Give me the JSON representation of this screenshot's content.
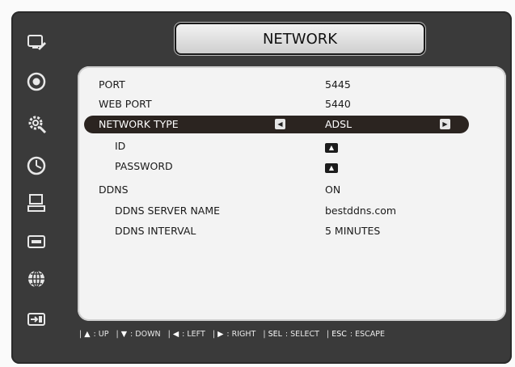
{
  "title": "NETWORK",
  "sidebar": {
    "items": [
      {
        "icon": "monitor-edit-icon"
      },
      {
        "icon": "record-disc-icon"
      },
      {
        "icon": "gear-icon"
      },
      {
        "icon": "clock-icon"
      },
      {
        "icon": "computer-icon"
      },
      {
        "icon": "hdd-icon"
      },
      {
        "icon": "globe-icon"
      },
      {
        "icon": "exit-icon"
      }
    ]
  },
  "settings": {
    "port": {
      "label": "PORT",
      "value": "5445"
    },
    "web_port": {
      "label": "WEB PORT",
      "value": "5440"
    },
    "network_type": {
      "label": "NETWORK TYPE",
      "value": "ADSL",
      "left_arrow": "◀",
      "right_arrow": "▶"
    },
    "id": {
      "label": "ID",
      "value_icon": "keypad-icon",
      "glyph": "▲"
    },
    "password": {
      "label": "PASSWORD",
      "value_icon": "keypad-icon",
      "glyph": "▲"
    },
    "ddns": {
      "label": "DDNS",
      "value": "ON"
    },
    "ddns_server_name": {
      "label": "DDNS SERVER NAME",
      "value": "bestddns.com"
    },
    "ddns_interval": {
      "label": "DDNS INTERVAL",
      "value": "5 MINUTES"
    }
  },
  "help": [
    {
      "key": "▲",
      "action": "UP"
    },
    {
      "key": "▼",
      "action": "DOWN"
    },
    {
      "key": "◀",
      "action": "LEFT"
    },
    {
      "key": "▶",
      "action": "RIGHT"
    },
    {
      "key": "SEL",
      "action": "SELECT"
    },
    {
      "key": "ESC",
      "action": "ESCAPE"
    }
  ],
  "colors": {
    "frame": "#3a3a3a",
    "panel": "#f3f3f3",
    "selected_row": "#2b2420"
  }
}
